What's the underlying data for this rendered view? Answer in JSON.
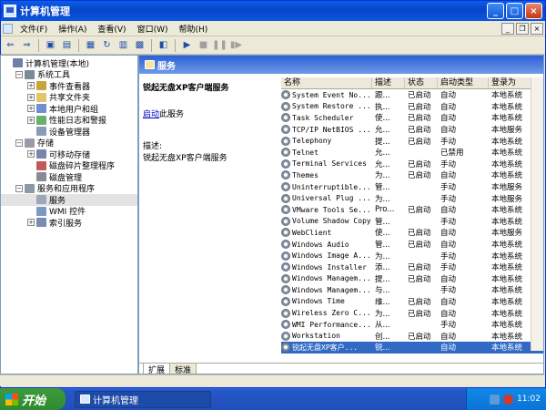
{
  "window": {
    "title": "计算机管理",
    "minimize": "_",
    "maximize": "□",
    "close": "×"
  },
  "menu": [
    "文件(F)",
    "操作(A)",
    "查看(V)",
    "窗口(W)",
    "帮助(H)"
  ],
  "mdi": {
    "minimize": "_",
    "restore": "❐",
    "close": "×"
  },
  "tree": [
    {
      "label": "计算机管理(本地)",
      "level": 0,
      "exp": "",
      "color": "#6c7fa6"
    },
    {
      "label": "系统工具",
      "level": 1,
      "exp": "−",
      "color": "#7a8a9a"
    },
    {
      "label": "事件查看器",
      "level": 2,
      "exp": "+",
      "color": "#c9a43a"
    },
    {
      "label": "共享文件夹",
      "level": 2,
      "exp": "+",
      "color": "#e3c46a"
    },
    {
      "label": "本地用户和组",
      "level": 2,
      "exp": "+",
      "color": "#6f8fd0"
    },
    {
      "label": "性能日志和警报",
      "level": 2,
      "exp": "+",
      "color": "#6ab06a"
    },
    {
      "label": "设备管理器",
      "level": 2,
      "exp": "",
      "color": "#8a9ab8"
    },
    {
      "label": "存储",
      "level": 1,
      "exp": "−",
      "color": "#9a9aa8"
    },
    {
      "label": "可移动存储",
      "level": 2,
      "exp": "+",
      "color": "#7a86a8"
    },
    {
      "label": "磁盘碎片整理程序",
      "level": 2,
      "exp": "",
      "color": "#c25a5a"
    },
    {
      "label": "磁盘管理",
      "level": 2,
      "exp": "",
      "color": "#8a8a96"
    },
    {
      "label": "服务和应用程序",
      "level": 1,
      "exp": "−",
      "color": "#8a9aa8"
    },
    {
      "label": "服务",
      "level": 2,
      "exp": "",
      "color": "#9aa8b8",
      "selected": true
    },
    {
      "label": "WMI 控件",
      "level": 2,
      "exp": "",
      "color": "#7a9ac0"
    },
    {
      "label": "索引服务",
      "level": 2,
      "exp": "+",
      "color": "#7a8ab0"
    }
  ],
  "panel": {
    "header": "服务",
    "service_name": "锐起无盘XP客户端服务",
    "start_link": "启动",
    "start_text": "此服务",
    "desc_label": "描述:",
    "desc_text": "锐起无盘XP客户端服务"
  },
  "columns": [
    "名称",
    "描述",
    "状态",
    "启动类型",
    "登录为"
  ],
  "services": [
    {
      "name": "System Event No...",
      "desc": "跟...",
      "status": "已启动",
      "startup": "自动",
      "logon": "本地系统"
    },
    {
      "name": "System Restore ...",
      "desc": "执...",
      "status": "已启动",
      "startup": "自动",
      "logon": "本地系统"
    },
    {
      "name": "Task Scheduler",
      "desc": "使...",
      "status": "已启动",
      "startup": "自动",
      "logon": "本地系统"
    },
    {
      "name": "TCP/IP NetBIOS ...",
      "desc": "允...",
      "status": "已启动",
      "startup": "自动",
      "logon": "本地服务"
    },
    {
      "name": "Telephony",
      "desc": "提...",
      "status": "已启动",
      "startup": "手动",
      "logon": "本地系统"
    },
    {
      "name": "Telnet",
      "desc": "允...",
      "status": "",
      "startup": "已禁用",
      "logon": "本地系统"
    },
    {
      "name": "Terminal Services",
      "desc": "允...",
      "status": "已启动",
      "startup": "手动",
      "logon": "本地系统"
    },
    {
      "name": "Themes",
      "desc": "为...",
      "status": "已启动",
      "startup": "自动",
      "logon": "本地系统"
    },
    {
      "name": "Uninterruptible...",
      "desc": "管...",
      "status": "",
      "startup": "手动",
      "logon": "本地服务"
    },
    {
      "name": "Universal Plug ...",
      "desc": "为...",
      "status": "",
      "startup": "手动",
      "logon": "本地服务"
    },
    {
      "name": "VMware Tools Se...",
      "desc": "Pro...",
      "status": "已启动",
      "startup": "自动",
      "logon": "本地系统"
    },
    {
      "name": "Volume Shadow Copy",
      "desc": "管...",
      "status": "",
      "startup": "手动",
      "logon": "本地系统"
    },
    {
      "name": "WebClient",
      "desc": "使...",
      "status": "已启动",
      "startup": "自动",
      "logon": "本地服务"
    },
    {
      "name": "Windows Audio",
      "desc": "管...",
      "status": "已启动",
      "startup": "自动",
      "logon": "本地系统"
    },
    {
      "name": "Windows Image A...",
      "desc": "为...",
      "status": "",
      "startup": "手动",
      "logon": "本地系统"
    },
    {
      "name": "Windows Installer",
      "desc": "添...",
      "status": "已启动",
      "startup": "手动",
      "logon": "本地系统"
    },
    {
      "name": "Windows Managem...",
      "desc": "提...",
      "status": "已启动",
      "startup": "自动",
      "logon": "本地系统"
    },
    {
      "name": "Windows Managem...",
      "desc": "与...",
      "status": "",
      "startup": "手动",
      "logon": "本地系统"
    },
    {
      "name": "Windows Time",
      "desc": "维...",
      "status": "已启动",
      "startup": "自动",
      "logon": "本地系统"
    },
    {
      "name": "Wireless Zero C...",
      "desc": "为...",
      "status": "已启动",
      "startup": "自动",
      "logon": "本地系统"
    },
    {
      "name": "WMI Performance...",
      "desc": "从...",
      "status": "",
      "startup": "手动",
      "logon": "本地系统"
    },
    {
      "name": "Workstation",
      "desc": "创...",
      "status": "已启动",
      "startup": "自动",
      "logon": "本地系统"
    },
    {
      "name": "锐起无盘XP客户...",
      "desc": "锐...",
      "status": "",
      "startup": "自动",
      "logon": "本地系统",
      "selected": true
    }
  ],
  "tabs": [
    "扩展",
    "标准"
  ],
  "taskbar": {
    "start": "开始",
    "task": "计算机管理",
    "clock": "11:02"
  }
}
